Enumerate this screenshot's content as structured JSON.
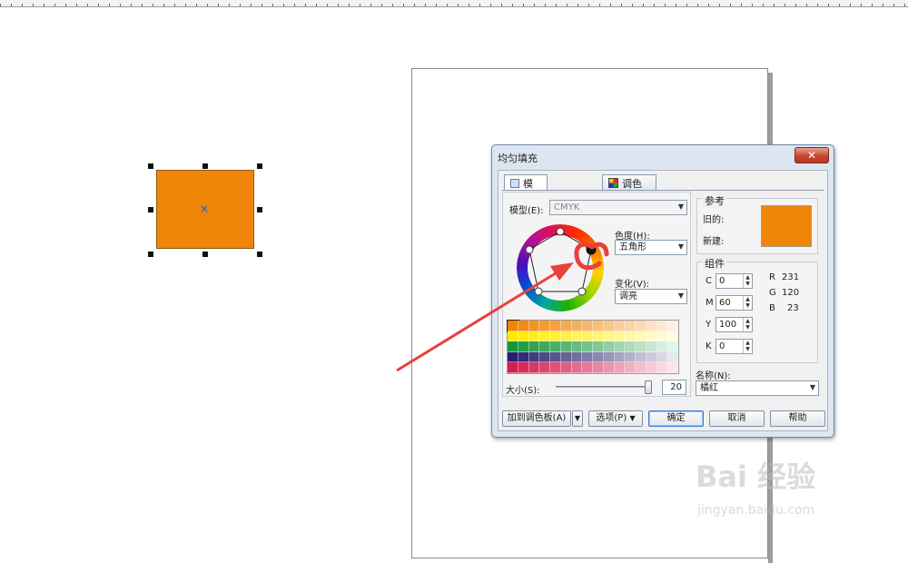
{
  "colors": {
    "fill": "#f08508",
    "arrow": "#e8413a",
    "dialog_bg": "#dde5f0"
  },
  "dialog": {
    "title": "均匀填充",
    "close_label": "✕",
    "tabs": [
      {
        "label": "模型",
        "icon": "cube-icon"
      },
      {
        "label": "调色板",
        "icon": "palette-icon"
      }
    ],
    "model_label": "模型(E):",
    "model_value": "CMYK",
    "hue_label": "色度(H):",
    "hue_value": "五角形",
    "variation_label": "变化(V):",
    "variation_value": "调亮",
    "size_label": "大小(S):",
    "size_value": "20",
    "reference": {
      "title": "参考",
      "old_label": "旧的:",
      "new_label": "新建:",
      "old_color": "#f08508",
      "new_color": "#f08508"
    },
    "components": {
      "title": "组件",
      "cmyk": [
        {
          "label": "C",
          "value": "0"
        },
        {
          "label": "M",
          "value": "60"
        },
        {
          "label": "Y",
          "value": "100"
        },
        {
          "label": "K",
          "value": "0"
        }
      ],
      "rgb": [
        {
          "label": "R",
          "value": "231"
        },
        {
          "label": "G",
          "value": "120"
        },
        {
          "label": "B",
          "value": "23"
        }
      ]
    },
    "name_label": "名称(N):",
    "name_value": "橘红",
    "buttons": {
      "add_palette": "加到调色板(A)",
      "options": "选项(P)",
      "ok": "确定",
      "cancel": "取消",
      "help": "帮助"
    }
  },
  "watermark": {
    "main": "Bai 经验",
    "sub": "jingyan.baidu.com"
  }
}
